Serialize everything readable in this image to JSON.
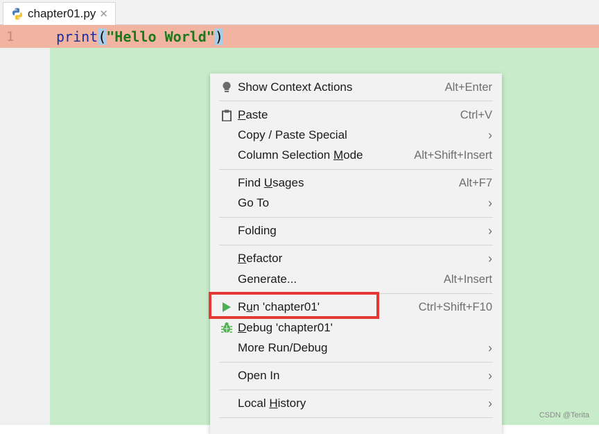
{
  "tab": {
    "label": "chapter01.py",
    "close": "✕"
  },
  "editor": {
    "line_number": "1",
    "code": {
      "fn": "print",
      "open": "(",
      "string": "\"Hello World\"",
      "close": ")"
    }
  },
  "menu": {
    "items": [
      {
        "pre": "Show Context Actions",
        "ul": "",
        "post": "",
        "shortcut": "Alt+Enter",
        "submenu": false,
        "icon": "lightbulb-icon"
      },
      {
        "pre": "",
        "ul": "P",
        "post": "aste",
        "shortcut": "Ctrl+V",
        "submenu": false,
        "icon": "clipboard-icon"
      },
      {
        "pre": "Copy / Paste Special",
        "ul": "",
        "post": "",
        "shortcut": "",
        "submenu": true,
        "icon": ""
      },
      {
        "pre": "Column Selection ",
        "ul": "M",
        "post": "ode",
        "shortcut": "Alt+Shift+Insert",
        "submenu": false,
        "icon": ""
      },
      {
        "pre": "Find ",
        "ul": "U",
        "post": "sages",
        "shortcut": "Alt+F7",
        "submenu": false,
        "icon": ""
      },
      {
        "pre": "Go To",
        "ul": "",
        "post": "",
        "shortcut": "",
        "submenu": true,
        "icon": ""
      },
      {
        "pre": "Folding",
        "ul": "",
        "post": "",
        "shortcut": "",
        "submenu": true,
        "icon": ""
      },
      {
        "pre": "",
        "ul": "R",
        "post": "efactor",
        "shortcut": "",
        "submenu": true,
        "icon": ""
      },
      {
        "pre": "Generate...",
        "ul": "",
        "post": "",
        "shortcut": "Alt+Insert",
        "submenu": false,
        "icon": ""
      },
      {
        "pre": "R",
        "ul": "u",
        "post": "n 'chapter01'",
        "shortcut": "Ctrl+Shift+F10",
        "submenu": false,
        "icon": "run-icon"
      },
      {
        "pre": "",
        "ul": "D",
        "post": "ebug 'chapter01'",
        "shortcut": "",
        "submenu": false,
        "icon": "bug-icon"
      },
      {
        "pre": "More Run/Debug",
        "ul": "",
        "post": "",
        "shortcut": "",
        "submenu": true,
        "icon": ""
      },
      {
        "pre": "Open In",
        "ul": "",
        "post": "",
        "shortcut": "",
        "submenu": true,
        "icon": ""
      },
      {
        "pre": "Local ",
        "ul": "H",
        "post": "istory",
        "shortcut": "",
        "submenu": true,
        "icon": ""
      }
    ],
    "arrow": "›"
  },
  "watermark": "CSDN @Terita",
  "colors": {
    "line_highlight": "#f0b4a0",
    "code_background": "#c8ebca",
    "run_green": "#4caf50",
    "highlight_red": "#e53935"
  }
}
